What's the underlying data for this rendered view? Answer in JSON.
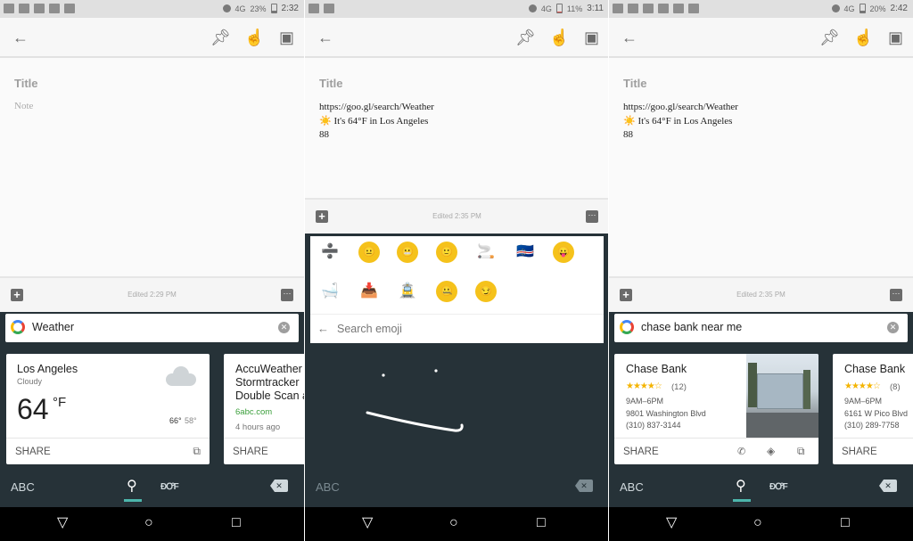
{
  "panels": [
    {
      "status": {
        "battery": "23%",
        "time": "2:32"
      },
      "note": {
        "title_placeholder": "Title",
        "body_placeholder": "Note"
      },
      "edited": "Edited 2:29 PM",
      "search": {
        "query": "Weather"
      },
      "card1": {
        "city": "Los Angeles",
        "condition": "Cloudy",
        "temp": "64",
        "unit": "°F",
        "high": "66°",
        "low": "58°",
        "share": "SHARE"
      },
      "card2": {
        "title_l1": "AccuWeather",
        "title_l2": "Stormtracker",
        "title_l3": "Double Scan a",
        "source": "6abc.com",
        "time": "4 hours ago",
        "share": "SHARE"
      },
      "keyboard": {
        "abc": "ABC",
        "emoji_label": "ĐꝌF"
      }
    },
    {
      "status": {
        "battery": "11%",
        "time": "3:11"
      },
      "note": {
        "title_placeholder": "Title",
        "line1": "https://goo.gl/search/Weather",
        "line2": "☀️ It's 64°F in Los Angeles",
        "line3": "88"
      },
      "edited": "Edited 2:35 PM",
      "emoji": {
        "row1": [
          "➗",
          "😐",
          "😬",
          "🙂",
          "🚬",
          "🇨🇻",
          "😛"
        ],
        "row2": [
          "🛁",
          "📥",
          "🚊",
          "🤐",
          "😏"
        ],
        "search_placeholder": "Search emoji"
      },
      "keyboard": {
        "abc": "ABC"
      }
    },
    {
      "status": {
        "battery": "20%",
        "time": "2:42"
      },
      "note": {
        "title_placeholder": "Title",
        "line1": "https://goo.gl/search/Weather",
        "line2": "☀️ It's 64°F in Los Angeles",
        "line3": "88"
      },
      "edited": "Edited 2:35 PM",
      "search": {
        "query": "chase bank near me"
      },
      "card1": {
        "name": "Chase Bank",
        "rating": 3.5,
        "stars": "★★★★☆",
        "reviews": "(12)",
        "hours": "9AM–6PM",
        "address": "9801 Washington Blvd",
        "phone": "(310) 837-3144",
        "share": "SHARE"
      },
      "card2": {
        "name": "Chase Bank",
        "rating": 4,
        "stars": "★★★★☆",
        "reviews": "(8)",
        "hours": "9AM–6PM",
        "address": "6161 W Pico Blvd",
        "phone": "(310) 289-7758",
        "share": "SHARE"
      },
      "keyboard": {
        "abc": "ABC",
        "emoji_label": "ĐꝌF"
      }
    }
  ],
  "colors": {
    "keyboard_bg": "#263238",
    "accent": "#4db6ac",
    "link_green": "#3a9e3a",
    "star": "#f4b400"
  }
}
